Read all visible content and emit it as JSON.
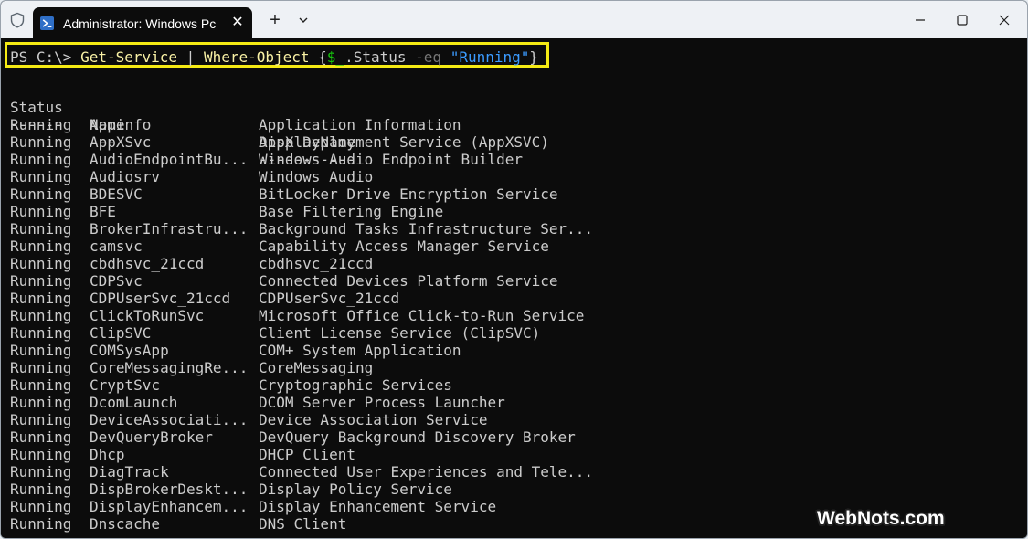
{
  "window": {
    "tab_title": "Administrator: Windows Pc",
    "tab_close": "✕",
    "new_tab": "+",
    "icons": {
      "shield": "shield-icon",
      "powershell": "powershell-icon",
      "dropdown": "chevron-down-icon",
      "minimize": "minimize-icon",
      "maximize": "maximize-icon",
      "close": "close-icon"
    }
  },
  "prompt": {
    "ps": "PS C:\\> ",
    "cmd1": "Get-Service",
    "pipe": " | ",
    "cmd2": "Where-Object",
    "brace_open": " {",
    "var": "$_",
    "prop": ".Status",
    "space1": " ",
    "op": "-eq",
    "space2": " ",
    "str": "\"Running\"",
    "brace_close": "}"
  },
  "columns": {
    "headers": [
      "Status",
      "Name",
      "DisplayName"
    ],
    "underline": [
      "------",
      "----",
      "-----------"
    ]
  },
  "services": [
    [
      "Running",
      "Appinfo",
      "Application Information"
    ],
    [
      "Running",
      "AppXSvc",
      "AppX Deployment Service (AppXSVC)"
    ],
    [
      "Running",
      "AudioEndpointBu...",
      "Windows Audio Endpoint Builder"
    ],
    [
      "Running",
      "Audiosrv",
      "Windows Audio"
    ],
    [
      "Running",
      "BDESVC",
      "BitLocker Drive Encryption Service"
    ],
    [
      "Running",
      "BFE",
      "Base Filtering Engine"
    ],
    [
      "Running",
      "BrokerInfrastru...",
      "Background Tasks Infrastructure Ser..."
    ],
    [
      "Running",
      "camsvc",
      "Capability Access Manager Service"
    ],
    [
      "Running",
      "cbdhsvc_21ccd",
      "cbdhsvc_21ccd"
    ],
    [
      "Running",
      "CDPSvc",
      "Connected Devices Platform Service"
    ],
    [
      "Running",
      "CDPUserSvc_21ccd",
      "CDPUserSvc_21ccd"
    ],
    [
      "Running",
      "ClickToRunSvc",
      "Microsoft Office Click-to-Run Service"
    ],
    [
      "Running",
      "ClipSVC",
      "Client License Service (ClipSVC)"
    ],
    [
      "Running",
      "COMSysApp",
      "COM+ System Application"
    ],
    [
      "Running",
      "CoreMessagingRe...",
      "CoreMessaging"
    ],
    [
      "Running",
      "CryptSvc",
      "Cryptographic Services"
    ],
    [
      "Running",
      "DcomLaunch",
      "DCOM Server Process Launcher"
    ],
    [
      "Running",
      "DeviceAssociati...",
      "Device Association Service"
    ],
    [
      "Running",
      "DevQueryBroker",
      "DevQuery Background Discovery Broker"
    ],
    [
      "Running",
      "Dhcp",
      "DHCP Client"
    ],
    [
      "Running",
      "DiagTrack",
      "Connected User Experiences and Tele..."
    ],
    [
      "Running",
      "DispBrokerDeskt...",
      "Display Policy Service"
    ],
    [
      "Running",
      "DisplayEnhancem...",
      "Display Enhancement Service"
    ],
    [
      "Running",
      "Dnscache",
      "DNS Client"
    ]
  ],
  "watermark": "WebNots.com"
}
